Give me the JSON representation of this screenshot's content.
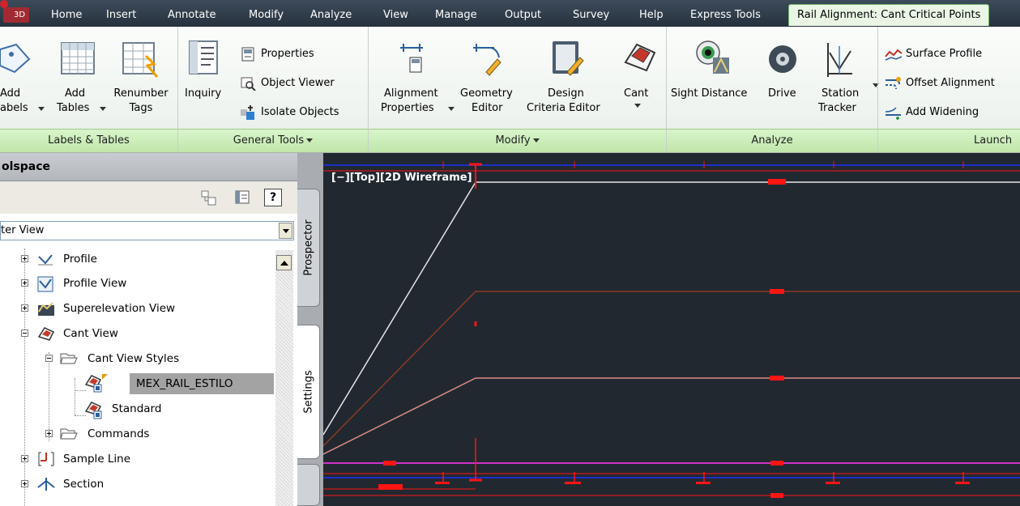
{
  "tabs": {
    "app_badge": "3D",
    "items": [
      "Home",
      "Insert",
      "Annotate",
      "Modify",
      "Analyze",
      "View",
      "Manage",
      "Output",
      "Survey",
      "Help",
      "Express Tools"
    ],
    "active": "Rail Alignment: Cant Critical Points"
  },
  "ribbon": {
    "labels_tables": {
      "panel": "Labels & Tables",
      "add_labels_line1": "Add",
      "add_labels_line2": "abels",
      "add_tables_line1": "Add",
      "add_tables_line2": "Tables",
      "renumber_line1": "Renumber",
      "renumber_line2": "Tags"
    },
    "general_tools": {
      "panel": "General Tools",
      "inquiry": "Inquiry",
      "properties": "Properties",
      "object_viewer": "Object Viewer",
      "isolate_objects": "Isolate Objects"
    },
    "modify": {
      "panel": "Modify",
      "alignment_line1": "Alignment",
      "alignment_line2": "Properties",
      "geometry_line1": "Geometry",
      "geometry_line2": "Editor",
      "design_line1": "Design",
      "design_line2": "Criteria Editor",
      "cant": "Cant"
    },
    "analyze": {
      "panel": "Analyze",
      "sight_distance": "Sight Distance",
      "drive": "Drive",
      "station_line1": "Station",
      "station_line2": "Tracker"
    },
    "launch": {
      "panel": "Launch",
      "surface_profile": "Surface Profile",
      "offset_alignment": "Offset Alignment",
      "add_widening": "Add Widening"
    }
  },
  "toolspace": {
    "title": "olspace",
    "view_combo": "ter View",
    "tabs": {
      "prospector": "Prospector",
      "settings": "Settings"
    },
    "tree": {
      "profile": "Profile",
      "profile_view": "Profile View",
      "superelevation_view": "Superelevation View",
      "cant_view": "Cant View",
      "cant_view_styles": "Cant View Styles",
      "mex_rail_estilo": "MEX_RAIL_ESTILO",
      "standard": "Standard",
      "commands": "Commands",
      "sample_line": "Sample Line",
      "section": "Section"
    }
  },
  "viewport": {
    "label": "[−][Top][2D Wireframe]",
    "colors": {
      "background": "#212830",
      "white_line": "#e6e6e6",
      "brown_line": "#8a3a22",
      "pink_line": "#e08a86",
      "magenta_line": "#d030c8",
      "red": "#ff1414",
      "blue": "#1c2ec8"
    }
  }
}
